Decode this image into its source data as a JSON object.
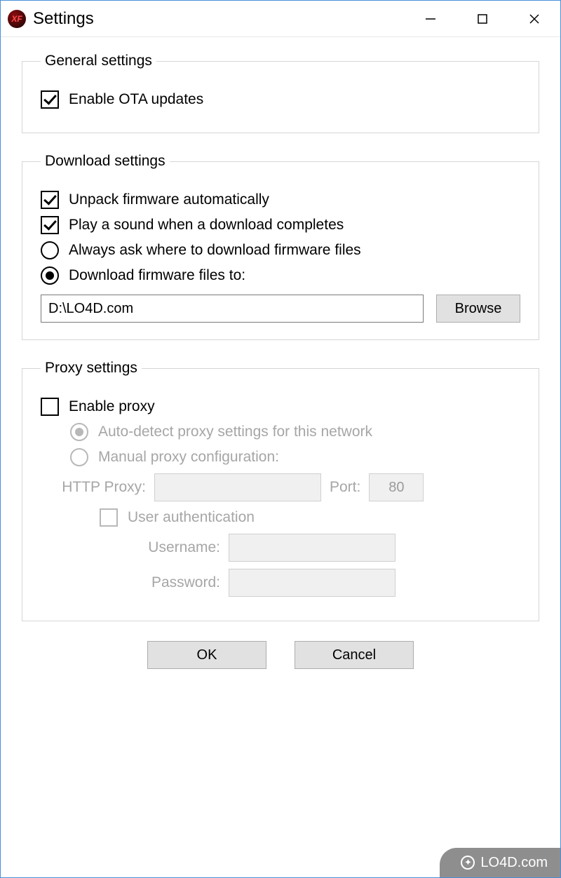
{
  "window": {
    "title": "Settings"
  },
  "general": {
    "legend": "General settings",
    "enable_ota": {
      "label": "Enable OTA updates",
      "checked": true
    }
  },
  "download": {
    "legend": "Download settings",
    "unpack": {
      "label": "Unpack firmware automatically",
      "checked": true
    },
    "play_sound": {
      "label": "Play a sound when a download completes",
      "checked": true
    },
    "ask_where": {
      "label": "Always ask where to download firmware files",
      "selected": false
    },
    "download_to": {
      "label": "Download firmware files to:",
      "selected": true
    },
    "path": "D:\\LO4D.com",
    "browse": "Browse"
  },
  "proxy": {
    "legend": "Proxy settings",
    "enable": {
      "label": "Enable proxy",
      "checked": false
    },
    "auto": {
      "label": "Auto-detect proxy settings for this network",
      "selected": true
    },
    "manual": {
      "label": "Manual proxy configuration:",
      "selected": false
    },
    "http_label": "HTTP Proxy:",
    "http_value": "",
    "port_label": "Port:",
    "port_value": "80",
    "user_auth": {
      "label": "User authentication",
      "checked": false
    },
    "username_label": "Username:",
    "username_value": "",
    "password_label": "Password:",
    "password_value": ""
  },
  "buttons": {
    "ok": "OK",
    "cancel": "Cancel"
  },
  "watermark": "LO4D.com"
}
